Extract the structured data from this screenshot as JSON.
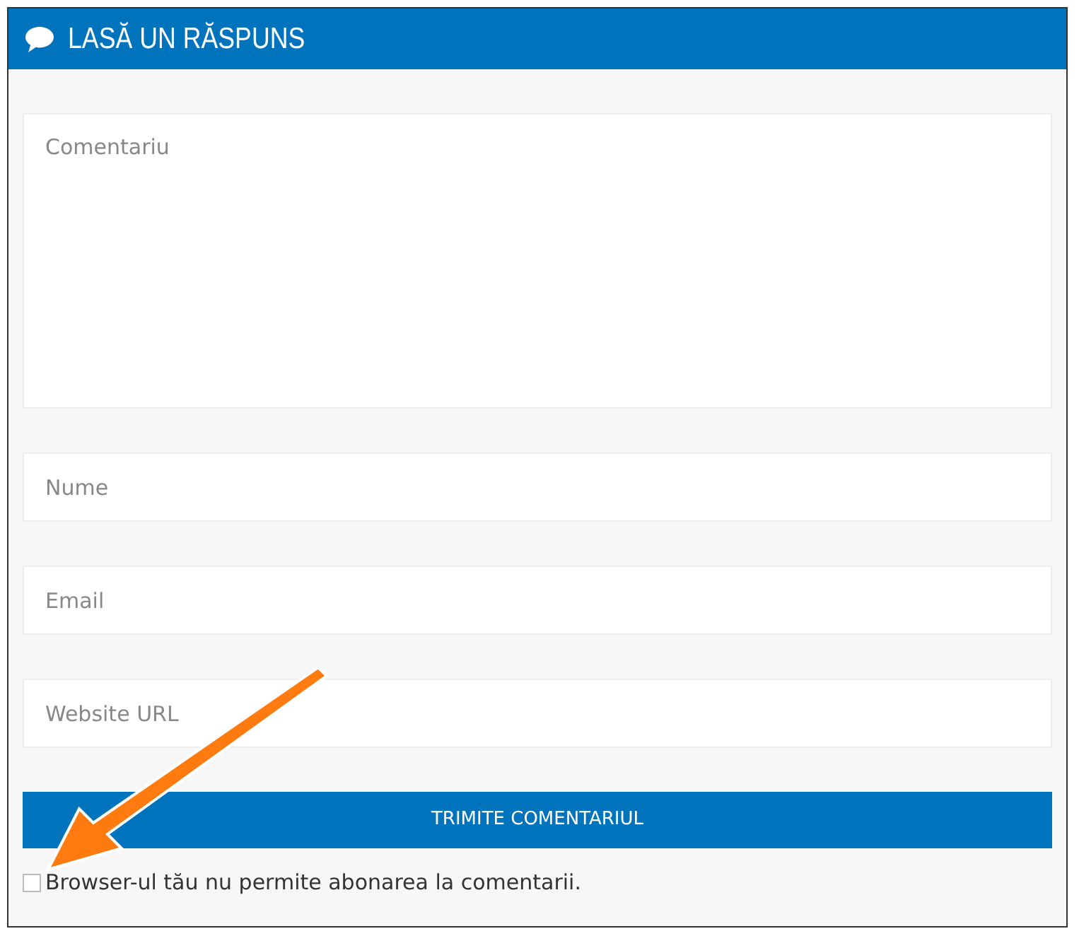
{
  "panel": {
    "title": "LASĂ UN RĂSPUNS"
  },
  "fields": [
    {
      "kind": "textarea",
      "placeholder": "Comentariu"
    },
    {
      "kind": "input",
      "placeholder": "Nume"
    },
    {
      "kind": "input",
      "placeholder": "Email"
    },
    {
      "kind": "input",
      "placeholder": "Website URL"
    }
  ],
  "submit_button": "TRIMITE COMENTARIUL",
  "subscribe": {
    "label": "Browser-ul tău nu permite abonarea la comentarii.",
    "checked": false
  }
}
